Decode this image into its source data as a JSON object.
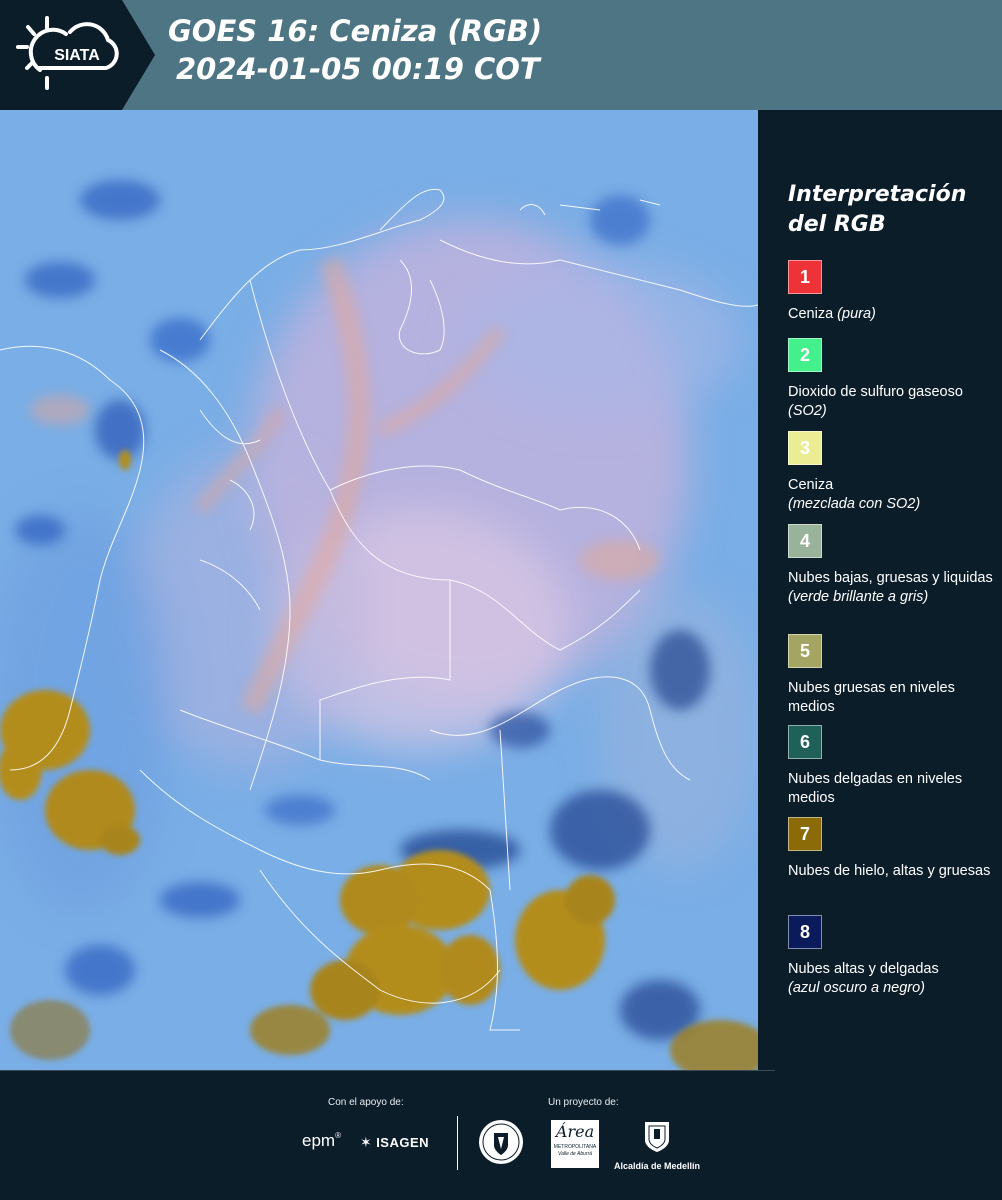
{
  "header": {
    "logo_text": "SIATA",
    "title_line1": "GOES 16: Ceniza (RGB)",
    "title_line2": "2024-01-05 00:19 COT"
  },
  "legend": {
    "title": "Interpretación del RGB",
    "items": [
      {
        "number": "1",
        "color": "#ee3338",
        "text": "Ceniza ",
        "note": "(pura)"
      },
      {
        "number": "2",
        "color": "#44f08c",
        "text": "Dioxido de sulfuro gaseoso ",
        "note": "(SO2)"
      },
      {
        "number": "3",
        "color": "#ecec95",
        "text": "Ceniza",
        "note": "(mezclada con SO2)"
      },
      {
        "number": "4",
        "color": "#98b39a",
        "text": "Nubes bajas, gruesas y liquidas",
        "note": "(verde brillante a gris)"
      },
      {
        "number": "5",
        "color": "#a5a563",
        "text": "Nubes gruesas en niveles medios",
        "note": ""
      },
      {
        "number": "6",
        "color": "#1f6158",
        "text": "Nubes delgadas en niveles medios",
        "note": ""
      },
      {
        "number": "7",
        "color": "#8a6b07",
        "text": "Nubes de hielo, altas y gruesas",
        "note": ""
      },
      {
        "number": "8",
        "color": "#0a1a5a",
        "text": "Nubes altas y delgadas",
        "note": "(azul oscuro a negro)"
      }
    ]
  },
  "footer": {
    "support_caption": "Con el apoyo de:",
    "project_caption": "Un proyecto de:",
    "epm": "epm",
    "isagen": "ISAGEN",
    "area_title": "Área",
    "area_sub1": "METROPOLITANA",
    "area_sub2": "Valle de Aburrá",
    "alcaldia": "Alcaldía de Medellín"
  }
}
